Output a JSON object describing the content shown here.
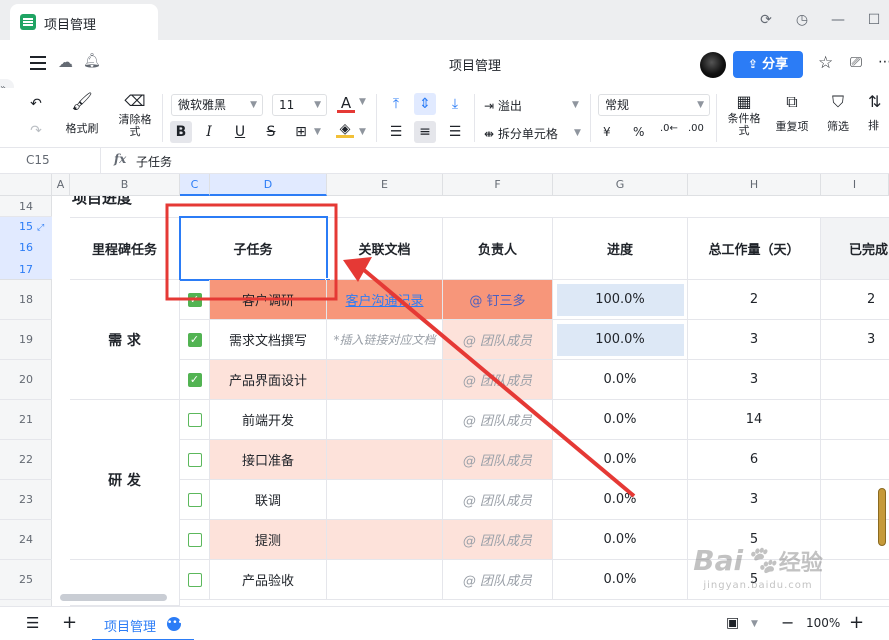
{
  "window": {
    "tab_title": "项目管理"
  },
  "header": {
    "doc_title": "项目管理",
    "share_label": "分享"
  },
  "toolbar": {
    "format_painter": "格式刷",
    "clear_format_line1": "清除格",
    "clear_format_line2": "式",
    "font_name": "微软雅黑",
    "font_size": "11",
    "overflow": "溢出",
    "split_cells": "拆分单元格",
    "number_format": "常规",
    "currency_symbol": "¥",
    "percent_symbol": "%",
    "cond_format_line1": "条件格",
    "cond_format_line2": "式",
    "duplicates": "重复项",
    "filter": "筛选",
    "sort_partial": "排"
  },
  "formula_bar": {
    "cell_ref": "C15",
    "fx": "fx",
    "value": "子任务"
  },
  "columns": [
    "A",
    "B",
    "C",
    "D",
    "E",
    "F",
    "G",
    "H",
    "I"
  ],
  "rows": [
    "14",
    "15",
    "16",
    "17",
    "18",
    "19",
    "20",
    "21",
    "22",
    "23",
    "24",
    "25"
  ],
  "table": {
    "section_title_partial": "项目进度",
    "headers": {
      "milestone": "里程碑任务",
      "subtask": "子任务",
      "docs": "关联文档",
      "owner": "负责人",
      "progress": "进度",
      "workload": "总工作量（天）",
      "done": "已完成"
    },
    "groups": [
      {
        "name": "需 求"
      },
      {
        "name": "研 发"
      }
    ],
    "tasks": [
      {
        "done": true,
        "name": "客户调研",
        "doc": "客户沟通记录",
        "owner": "@ 钉三多",
        "progress": "100.0%",
        "total": "2",
        "completed": "2"
      },
      {
        "done": true,
        "name": "需求文档撰写",
        "doc": "*插入链接对应文档",
        "owner": "@ 团队成员",
        "progress": "100.0%",
        "total": "3",
        "completed": "3"
      },
      {
        "done": true,
        "name": "产品界面设计",
        "doc": "",
        "owner": "@ 团队成员",
        "progress": "0.0%",
        "total": "3",
        "completed": ""
      },
      {
        "done": false,
        "name": "前端开发",
        "doc": "",
        "owner": "@ 团队成员",
        "progress": "0.0%",
        "total": "14",
        "completed": ""
      },
      {
        "done": false,
        "name": "接口准备",
        "doc": "",
        "owner": "@ 团队成员",
        "progress": "0.0%",
        "total": "6",
        "completed": ""
      },
      {
        "done": false,
        "name": "联调",
        "doc": "",
        "owner": "@ 团队成员",
        "progress": "0.0%",
        "total": "3",
        "completed": ""
      },
      {
        "done": false,
        "name": "提测",
        "doc": "",
        "owner": "@ 团队成员",
        "progress": "0.0%",
        "total": "5",
        "completed": ""
      },
      {
        "done": false,
        "name": "产品验收",
        "doc": "",
        "owner": "@ 团队成员",
        "progress": "0.0%",
        "total": "5",
        "completed": ""
      }
    ]
  },
  "bottom": {
    "sheet_tab": "项目管理",
    "zoom": "100%"
  },
  "watermark": {
    "brand": "Bai",
    "site": "经验",
    "url": "jingyan.baidu.com"
  },
  "colors": {
    "accent": "#2b7cf6",
    "annotation_red": "#e53935",
    "row_orange": "#f7967a",
    "row_pink": "#fde2da",
    "progress_blue": "#dde8f6",
    "checkbox_green": "#52b352"
  }
}
